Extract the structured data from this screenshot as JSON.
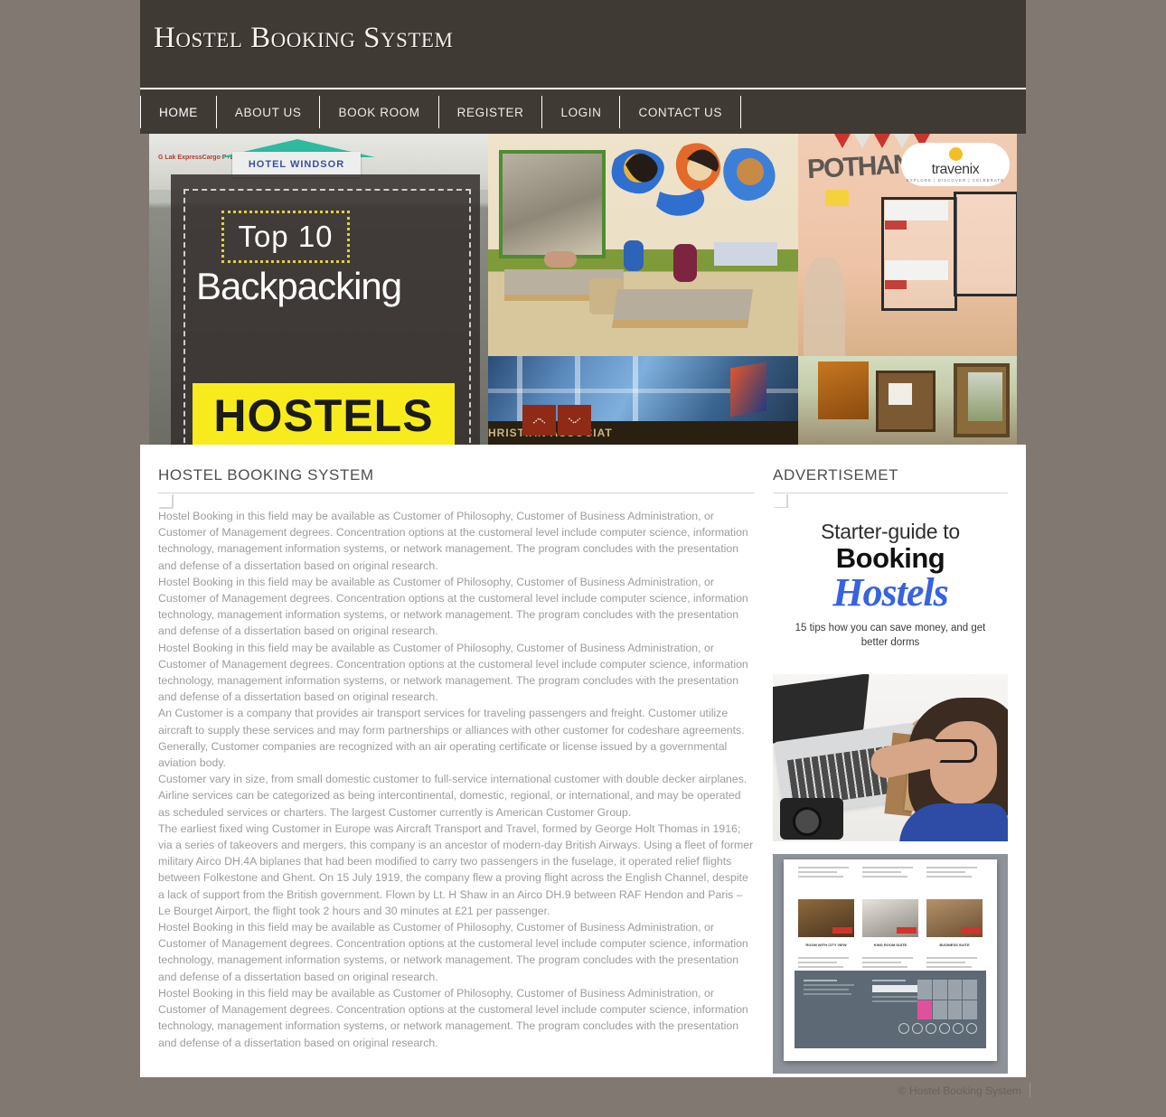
{
  "site": {
    "title": "Hostel Booking System",
    "accent_color": "#8E2A16",
    "header_bg": "#403A35",
    "page_bg": "#817872"
  },
  "nav": {
    "items": [
      {
        "label": "HOME",
        "name": "nav-home",
        "active": true
      },
      {
        "label": "ABOUT US",
        "name": "nav-about-us",
        "active": false
      },
      {
        "label": "BOOK ROOM",
        "name": "nav-book-room",
        "active": false
      },
      {
        "label": "REGISTER",
        "name": "nav-register",
        "active": false
      },
      {
        "label": "LOGIN",
        "name": "nav-login",
        "active": false
      },
      {
        "label": "CONTACT US",
        "name": "nav-contact-us",
        "active": false
      }
    ]
  },
  "slider": {
    "prev_label": "Previous slide",
    "next_label": "Next slide",
    "slide1": {
      "hotel_sign": "HOTEL WINDSOR",
      "cargo_sign": "G Lak ExpressCargo P+Ltd",
      "top_line": "Top 10",
      "mid_line": "Backpacking",
      "band_line": "HOSTELS"
    },
    "slide_photos": {
      "travenix_brand": "travenix",
      "travenix_tagline": "EXPLORE | DISCOVER | CELEBRATE",
      "wall_text": "POTHANDIKAD",
      "building_text": "HRISTIAN ASSOCIAT"
    }
  },
  "main": {
    "heading": "HOSTEL BOOKING SYSTEM",
    "paragraphs": [
      "Hostel Booking in this field may be available as Customer of Philosophy, Customer of Business Administration, or Customer of Management degrees. Concentration options at the customeral level include computer science, information technology, management information systems, or network management. The program concludes with the presentation and defense of a dissertation based on original research.",
      "Hostel Booking in this field may be available as Customer of Philosophy, Customer of Business Administration, or Customer of Management degrees. Concentration options at the customeral level include computer science, information technology, management information systems, or network management. The program concludes with the presentation and defense of a dissertation based on original research.",
      "Hostel Booking in this field may be available as Customer of Philosophy, Customer of Business Administration, or Customer of Management degrees. Concentration options at the customeral level include computer science, information technology, management information systems, or network management. The program concludes with the presentation and defense of a dissertation based on original research.",
      "An Customer is a company that provides air transport services for traveling passengers and freight. Customer utilize aircraft to supply these services and may form partnerships or alliances with other customer for codeshare agreements. Generally, Customer companies are recognized with an air operating certificate or license issued by a governmental aviation body.",
      "Customer vary in size, from small domestic customer to full-service international customer with double decker airplanes. Airline services can be categorized as being intercontinental, domestic, regional, or international, and may be operated as scheduled services or charters. The largest Customer currently is American Customer Group.",
      "The earliest fixed wing Customer in Europe was Aircraft Transport and Travel, formed by George Holt Thomas in 1916; via a series of takeovers and mergers, this company is an ancestor of modern-day British Airways. Using a fleet of former military Airco DH.4A biplanes that had been modified to carry two passengers in the fuselage, it operated relief flights between Folkestone and Ghent. On 15 July 1919, the company flew a proving flight across the English Channel, despite a lack of support from the British government. Flown by Lt. H Shaw in an Airco DH.9 between RAF Hendon and Paris – Le Bourget Airport, the flight took 2 hours and 30 minutes at £21 per passenger.",
      "Hostel Booking in this field may be available as Customer of Philosophy, Customer of Business Administration, or Customer of Management degrees. Concentration options at the customeral level include computer science, information technology, management information systems, or network management. The program concludes with the presentation and defense of a dissertation based on original research.",
      "Hostel Booking in this field may be available as Customer of Philosophy, Customer of Business Administration, or Customer of Management degrees. Concentration options at the customeral level include computer science, information technology, management information systems, or network management. The program concludes with the presentation and defense of a dissertation based on original research."
    ]
  },
  "sidebar": {
    "heading": "ADVERTISEMET",
    "ad1": {
      "line1": "Starter-guide to",
      "line2": "Booking",
      "line3": "Hostels",
      "line4": "15 tips how you can save money, and get better dorms"
    },
    "ad2": {
      "alt": "Woman writing in notebook beside laptop"
    },
    "ad3": {
      "alt": "Hotel booking website template preview",
      "card1": "ROOM WITH CITY VIEW",
      "card2": "KING ROOM SUITE",
      "card3": "BUSINESS SUITE"
    }
  },
  "footer": {
    "copyright": "© Hostel Booking System"
  }
}
